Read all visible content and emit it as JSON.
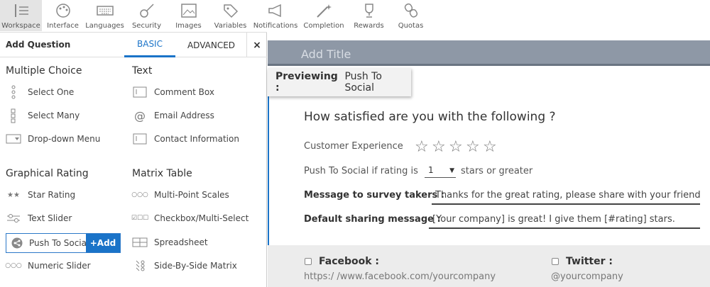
{
  "toolbar": {
    "items": [
      {
        "label": "Workspace",
        "icon": "workspace-icon"
      },
      {
        "label": "Interface",
        "icon": "palette-icon"
      },
      {
        "label": "Languages",
        "icon": "keyboard-icon"
      },
      {
        "label": "Security",
        "icon": "guitar-icon"
      },
      {
        "label": "Images",
        "icon": "image-icon"
      },
      {
        "label": "Variables",
        "icon": "tag-icon"
      },
      {
        "label": "Notifications",
        "icon": "megaphone-icon"
      },
      {
        "label": "Completion",
        "icon": "magic-wand-icon"
      },
      {
        "label": "Rewards",
        "icon": "trophy-icon"
      },
      {
        "label": "Quotas",
        "icon": "chain-icon"
      }
    ]
  },
  "panel": {
    "title": "Add Question",
    "tab_basic": "BASIC",
    "tab_advanced": "ADVANCED",
    "close": "×",
    "sections": {
      "multiple_choice": "Multiple Choice",
      "text": "Text",
      "graphical_rating": "Graphical Rating",
      "matrix_table": "Matrix Table"
    },
    "items": {
      "select_one": "Select One",
      "select_many": "Select Many",
      "dropdown": "Drop-down Menu",
      "comment_box": "Comment Box",
      "email": "Email Address",
      "contact": "Contact Information",
      "star_rating": "Star Rating",
      "text_slider": "Text Slider",
      "push_social": "Push To Social",
      "numeric_slider": "Numeric Slider",
      "multi_point": "Multi-Point Scales",
      "checkbox_multi": "Checkbox/Multi-Select",
      "spreadsheet": "Spreadsheet",
      "side_by_side": "Side-By-Side Matrix"
    },
    "add_button": "+Add"
  },
  "preview": {
    "title_placeholder": "Add Title",
    "badge_label": "Previewing :",
    "badge_value": "Push To Social",
    "question": "How satisfied are you with the following ?",
    "customer_experience": "Customer Experience",
    "push_if": "Push To Social if rating is",
    "rating_value": "1",
    "stars_or_greater": "stars or greater",
    "message_label": "Message to survey takers :",
    "message_value": "Thanks for the great rating, please share with your friends!",
    "default_label": "Default sharing message :",
    "default_value": "[Your company] is great! I give them [#rating] stars.",
    "facebook": "Facebook :",
    "facebook_url": "https:/ /www.facebook.com/yourcompany",
    "twitter": "Twitter :",
    "twitter_handle": "@yourcompany",
    "star_count": 5
  },
  "colors": {
    "accent": "#1a73c8",
    "title_bar": "#8e98a6",
    "active_tab_bg": "#e4e4e4"
  }
}
